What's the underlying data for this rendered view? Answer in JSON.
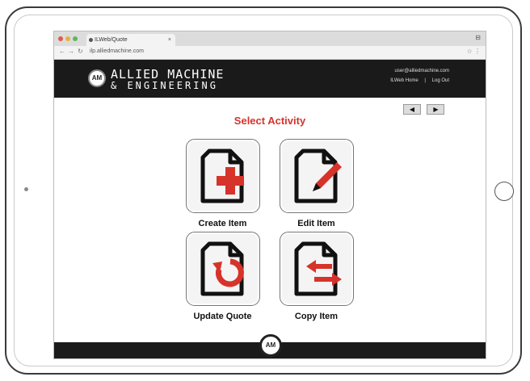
{
  "browser": {
    "tab_title": "ILWeb/Quote",
    "url": "ilp.alliedmachine.com",
    "tab_close": "×"
  },
  "header": {
    "brand_line1": "ALLIED MACHINE",
    "brand_line2": "& ENGINEERING",
    "logo_mark": "AM",
    "user_email": "user@alliedmachine.com",
    "home_link": "ILWeb Home",
    "logout_link": "Log Out",
    "separator": "|"
  },
  "nav": {
    "back": "◀",
    "forward": "▶"
  },
  "main": {
    "heading": "Select Activity",
    "tiles": [
      {
        "label": "Create Item",
        "icon": "create-item-icon"
      },
      {
        "label": "Edit Item",
        "icon": "edit-item-icon"
      },
      {
        "label": "Update Quote",
        "icon": "update-quote-icon"
      },
      {
        "label": "Copy Item",
        "icon": "copy-item-icon"
      }
    ]
  },
  "footer": {
    "logo_mark": "AM"
  },
  "colors": {
    "accent": "#d6332a",
    "header_bg": "#1a1a1a"
  }
}
